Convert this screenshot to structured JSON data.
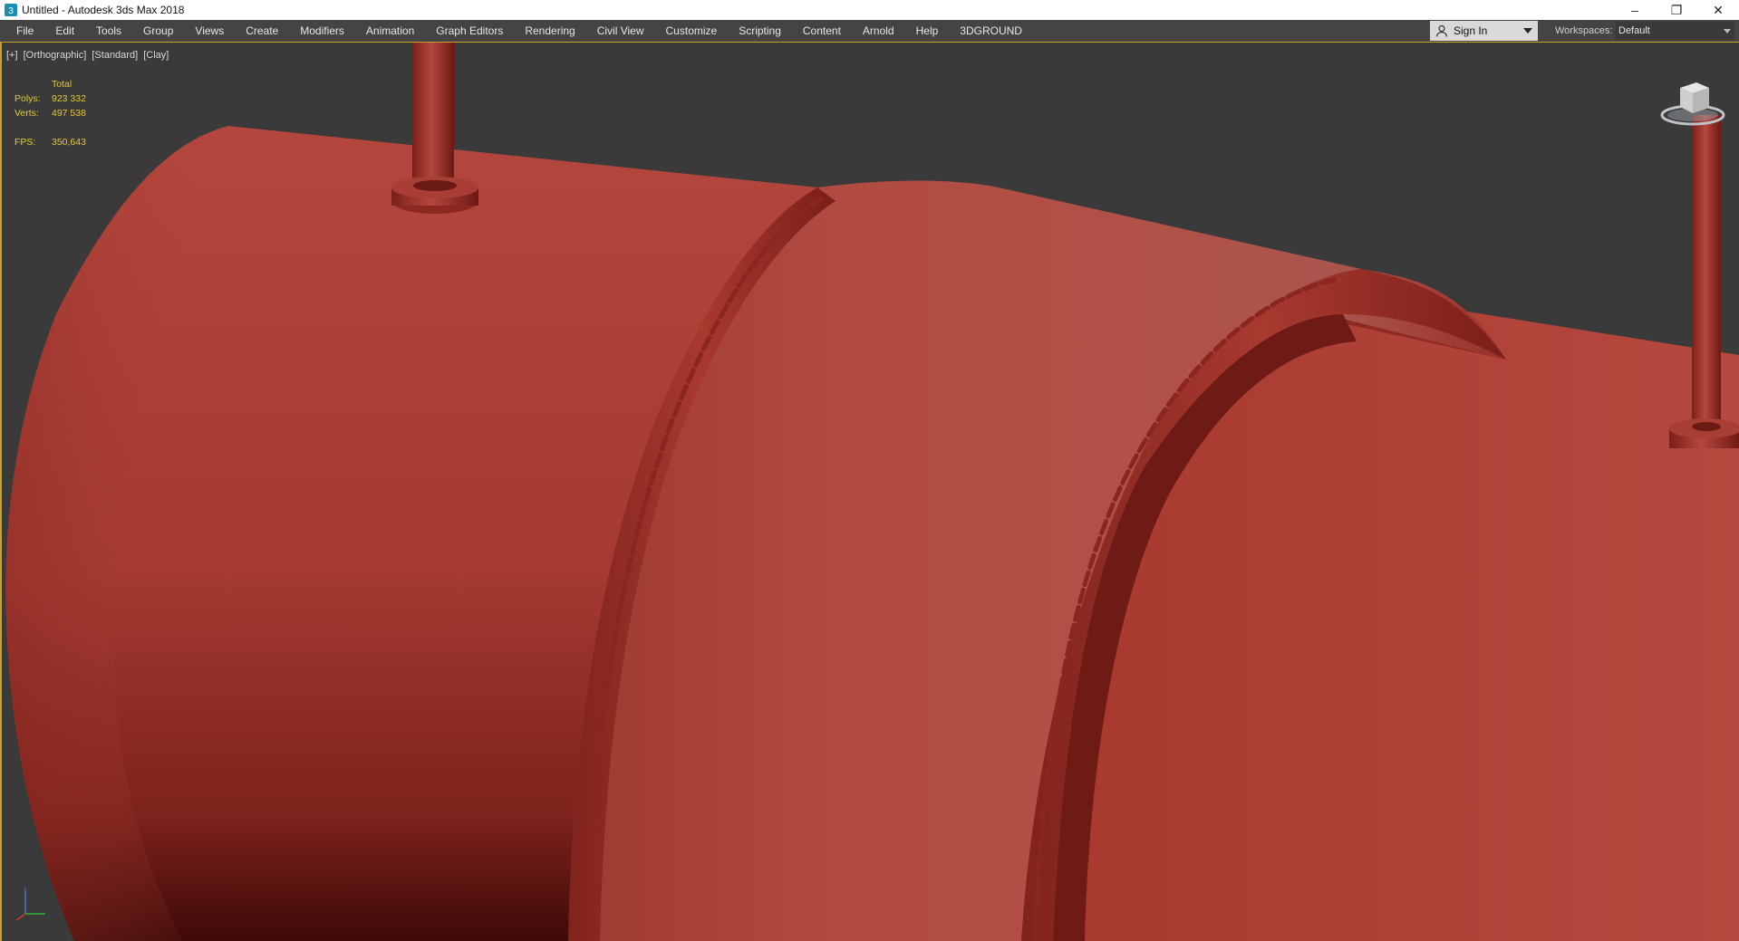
{
  "window": {
    "title": "Untitled - Autodesk 3ds Max 2018",
    "controls": {
      "minimize": "–",
      "restore": "❐",
      "close": "✕"
    }
  },
  "menu": {
    "items": [
      "File",
      "Edit",
      "Tools",
      "Group",
      "Views",
      "Create",
      "Modifiers",
      "Animation",
      "Graph Editors",
      "Rendering",
      "Civil View",
      "Customize",
      "Scripting",
      "Content",
      "Arnold",
      "Help",
      "3DGROUND"
    ]
  },
  "account": {
    "sign_in_label": "Sign In"
  },
  "workspaces": {
    "label": "Workspaces:",
    "value": "Default"
  },
  "viewport": {
    "labels": [
      "[+]",
      "[Orthographic]",
      "[Standard]",
      "[Clay]"
    ],
    "stats": {
      "header": "Total",
      "polys_label": "Polys:",
      "polys_value": "923 332",
      "verts_label": "Verts:",
      "verts_value": "497 538",
      "fps_label": "FPS:",
      "fps_value": "350,643"
    },
    "colors": {
      "background": "#3a3a3a",
      "clay": "#b5473d",
      "clay_shadow": "#6b1612",
      "stats_text": "#e7c928",
      "active_border": "#c9a227"
    }
  },
  "icons": {
    "app": "3ds-max-icon",
    "user": "person-icon",
    "viewcube": "viewcube-icon",
    "axis": "axis-tripod-icon"
  }
}
